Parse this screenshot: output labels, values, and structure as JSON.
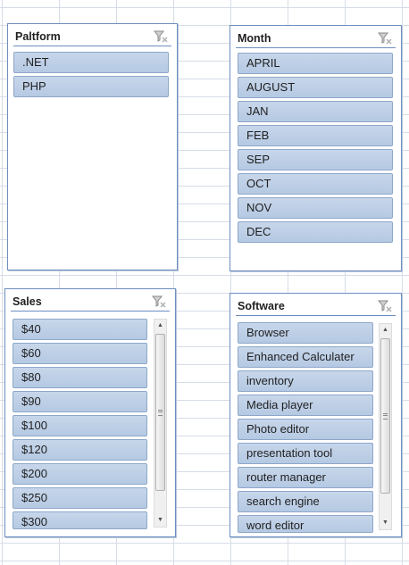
{
  "slicers": {
    "platform": {
      "title": "Paltform",
      "items": [
        ".NET",
        "PHP"
      ]
    },
    "month": {
      "title": "Month",
      "items": [
        "APRIL",
        "AUGUST",
        "JAN",
        "FEB",
        "SEP",
        "OCT",
        "NOV",
        "DEC"
      ]
    },
    "sales": {
      "title": "Sales",
      "items": [
        "$40",
        "$60",
        "$80",
        "$90",
        "$100",
        "$120",
        "$200",
        "$250",
        "$300"
      ]
    },
    "software": {
      "title": "Software",
      "items": [
        "Browser",
        "Enhanced Calculater",
        "inventory",
        "Media player",
        "Photo editor",
        "presentation tool",
        "router manager",
        "search engine",
        "word editor"
      ]
    }
  },
  "icons": {
    "clear_filter": "clear-filter-icon",
    "scroll_up": "scroll-up-arrow-icon",
    "scroll_down": "scroll-down-arrow-icon"
  },
  "colors": {
    "item_fill": "#b8cce4",
    "slicer_border": "#6d8fbf",
    "gridline": "#d6dde8"
  }
}
